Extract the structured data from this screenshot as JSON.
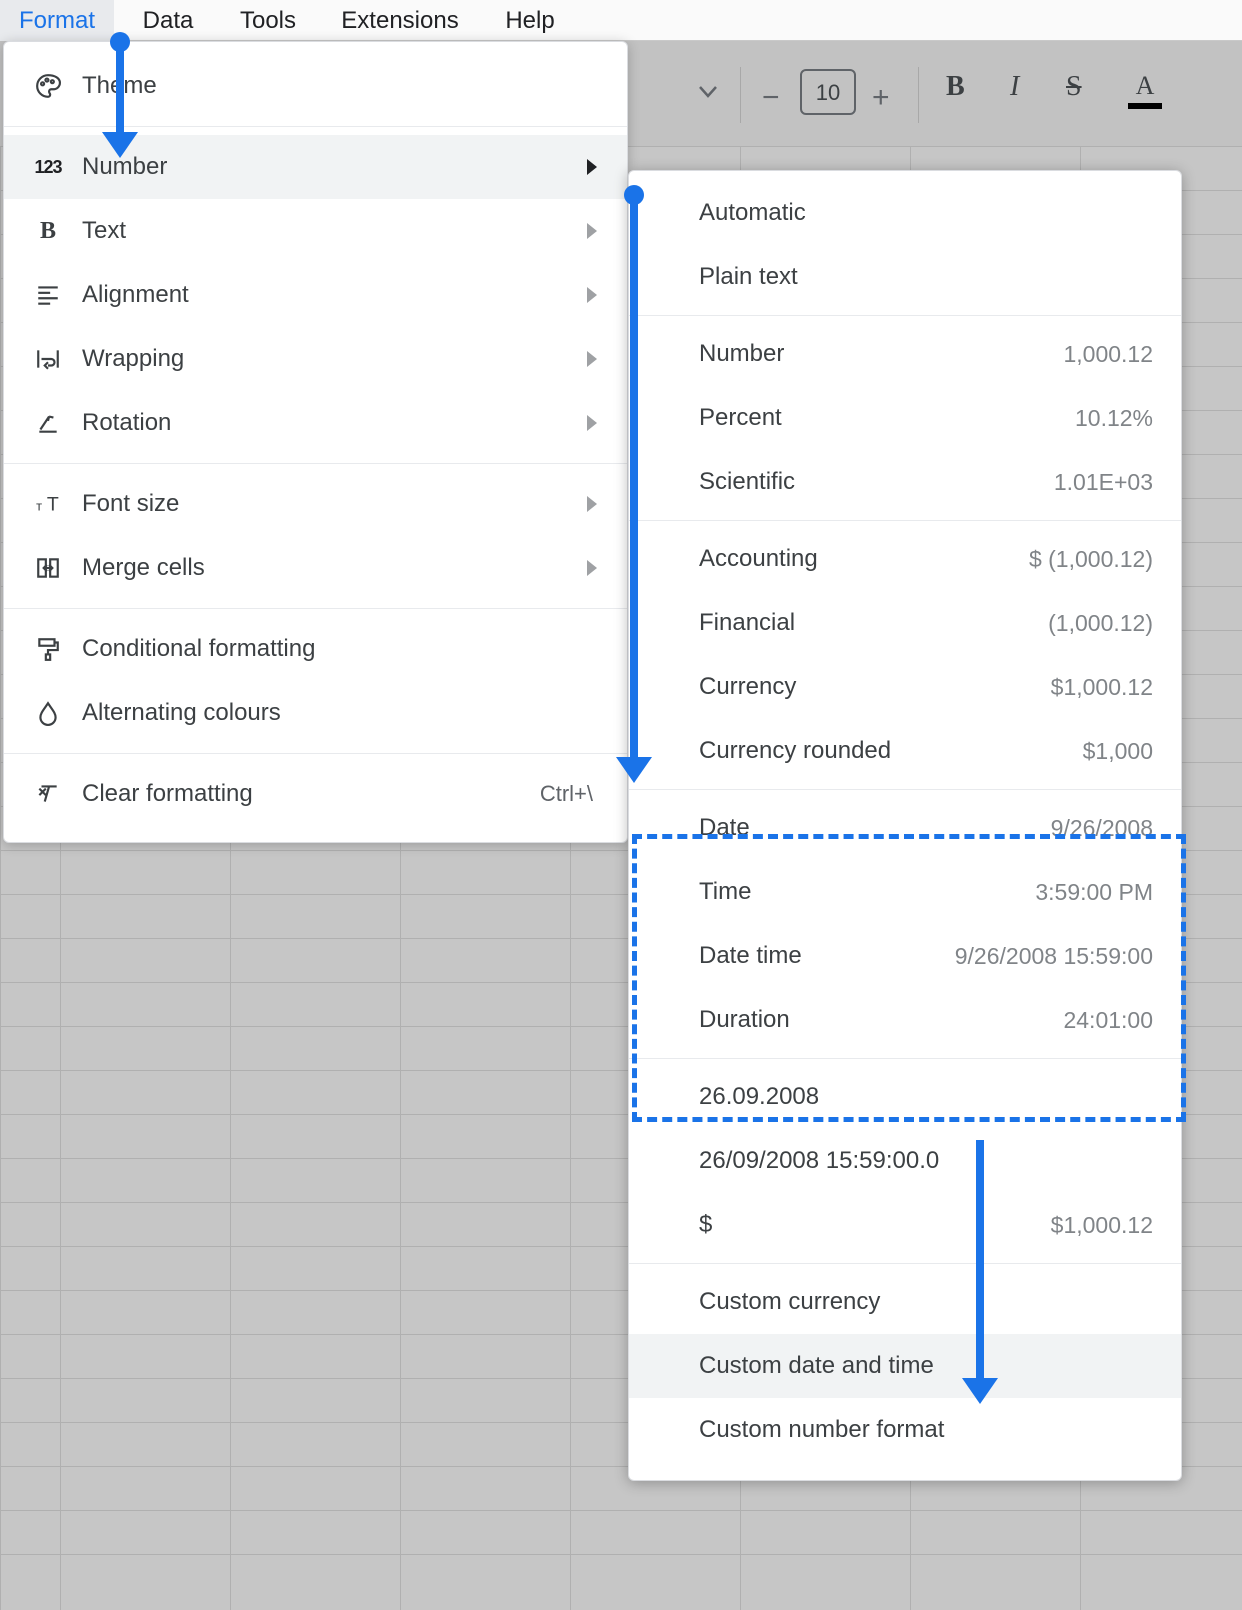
{
  "menubar": {
    "format": "Format",
    "data": "Data",
    "tools": "Tools",
    "extensions": "Extensions",
    "help": "Help"
  },
  "toolbar": {
    "font_size_value": "10"
  },
  "format_menu": {
    "theme": "Theme",
    "number": "Number",
    "text": "Text",
    "alignment": "Alignment",
    "wrapping": "Wrapping",
    "rotation": "Rotation",
    "font_size": "Font size",
    "merge_cells": "Merge cells",
    "conditional_formatting": "Conditional formatting",
    "alternating_colours": "Alternating colours",
    "clear_formatting": "Clear formatting",
    "clear_formatting_shortcut": "Ctrl+\\"
  },
  "number_menu": {
    "automatic": "Automatic",
    "plain_text": "Plain text",
    "number_label": "Number",
    "number_example": "1,000.12",
    "percent_label": "Percent",
    "percent_example": "10.12%",
    "scientific_label": "Scientific",
    "scientific_example": "1.01E+03",
    "accounting_label": "Accounting",
    "accounting_example": "$ (1,000.12)",
    "financial_label": "Financial",
    "financial_example": "(1,000.12)",
    "currency_label": "Currency",
    "currency_example": "$1,000.12",
    "currency_rounded_label": "Currency rounded",
    "currency_rounded_example": "$1,000",
    "date_label": "Date",
    "date_example": "9/26/2008",
    "time_label": "Time",
    "time_example": "3:59:00 PM",
    "date_time_label": "Date time",
    "date_time_example": "9/26/2008 15:59:00",
    "duration_label": "Duration",
    "duration_example": "24:01:00",
    "alt_date_dot": "26.09.2008",
    "alt_datetime_slash": "26/09/2008 15:59:00.0",
    "dollar_label": "$",
    "dollar_example": "$1,000.12",
    "custom_currency": "Custom currency",
    "custom_date_time": "Custom date and time",
    "custom_number_format": "Custom number format"
  }
}
